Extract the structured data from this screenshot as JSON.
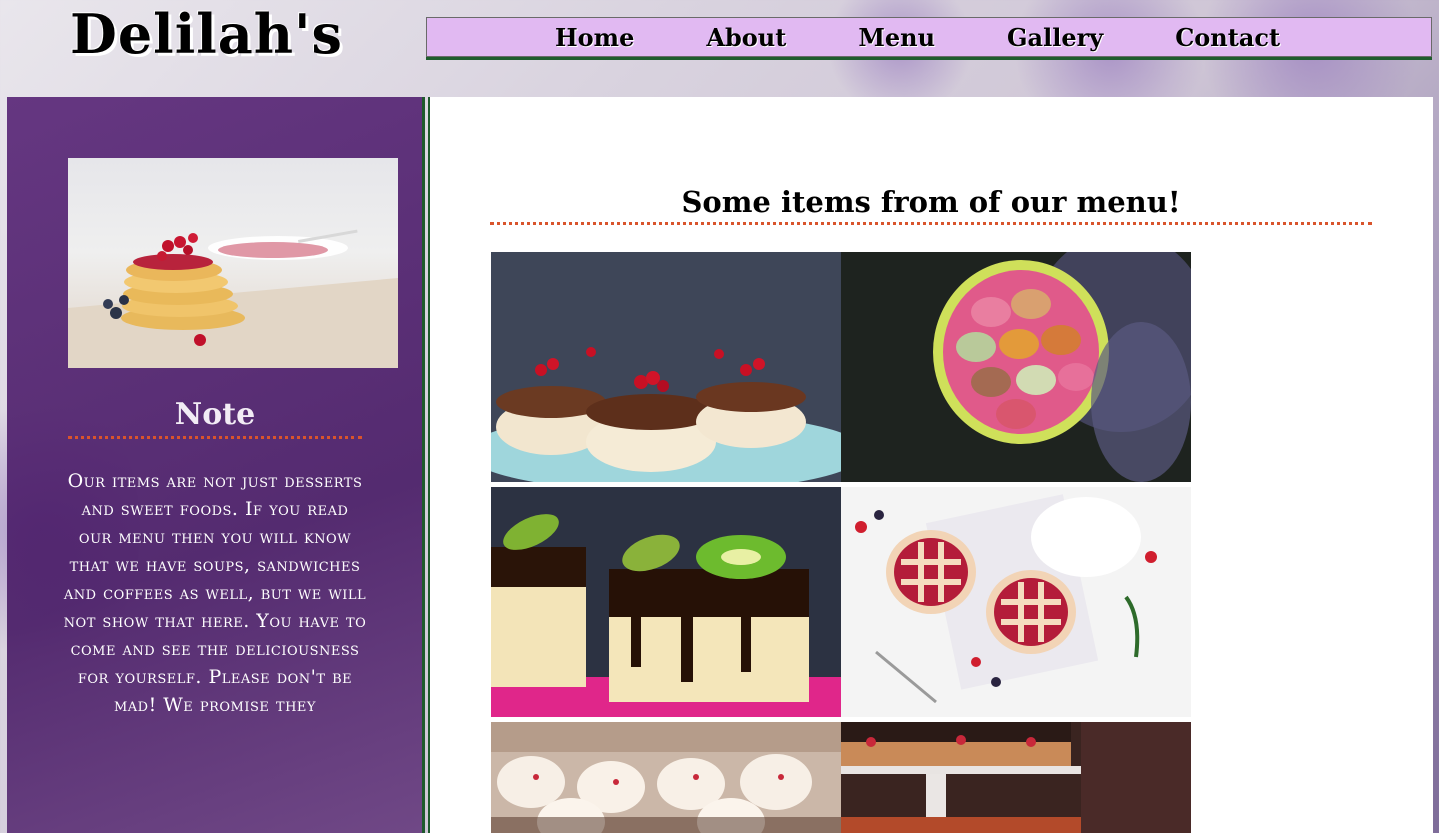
{
  "site": {
    "logo": "Delilah's"
  },
  "nav": {
    "items": [
      {
        "label": "Home"
      },
      {
        "label": "About"
      },
      {
        "label": "Menu"
      },
      {
        "label": "Gallery"
      },
      {
        "label": "Contact"
      }
    ]
  },
  "sidebar": {
    "note_heading": "Note",
    "note_text": "Our items are not just desserts and sweet foods. If you read our menu then you will know that we have soups, sandwiches and coffees as well, but we will not show that here. You have to come and see the deliciousness for yourself. Please don't be mad! We promise they"
  },
  "gallery": {
    "heading": "Some items from of our menu!"
  },
  "colors": {
    "nav_background": "#e1b9f2",
    "sidebar_purple": "#5a2878",
    "accent_dotted_rule": "#d9542c",
    "frame_green": "#1e5a2c"
  }
}
